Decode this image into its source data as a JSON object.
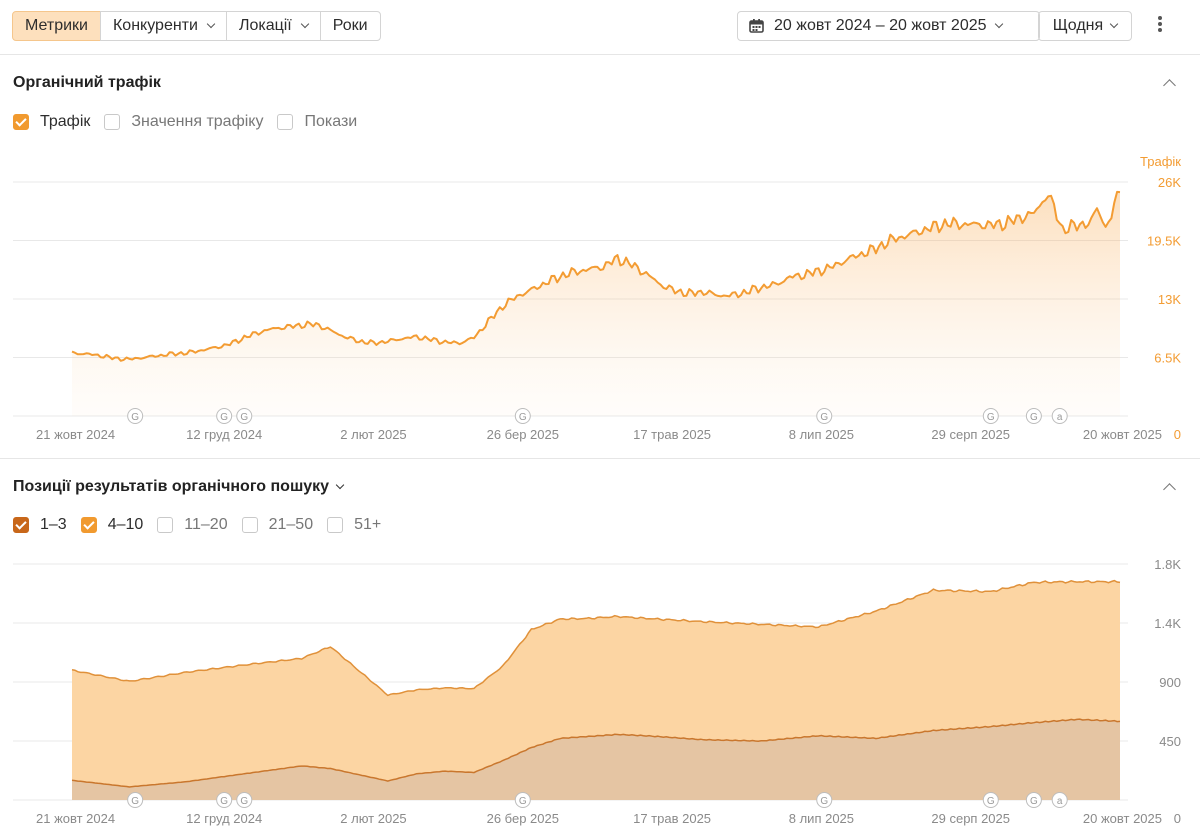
{
  "toolbar": {
    "tabs": [
      {
        "label": "Метрики",
        "active": true,
        "dropdown": false
      },
      {
        "label": "Конкуренти",
        "active": false,
        "dropdown": true
      },
      {
        "label": "Локації",
        "active": false,
        "dropdown": true
      },
      {
        "label": "Роки",
        "active": false,
        "dropdown": false
      }
    ],
    "date_range": "20 жовт 2024 – 20 жовт 2025",
    "interval": "Щодня"
  },
  "traffic_section": {
    "title": "Органічний трафік",
    "checkboxes": [
      {
        "label": "Трафік",
        "checked": true
      },
      {
        "label": "Значення трафіку",
        "checked": false
      },
      {
        "label": "Покази",
        "checked": false
      }
    ]
  },
  "positions_section": {
    "title": "Позиції результатів органічного пошуку",
    "checkboxes": [
      {
        "label": "1–3",
        "checked": true
      },
      {
        "label": "4–10",
        "checked": true
      },
      {
        "label": "11–20",
        "checked": false
      },
      {
        "label": "21–50",
        "checked": false
      },
      {
        "label": "51+",
        "checked": false
      }
    ]
  },
  "colors": {
    "traffic": "#f39c33",
    "pos_4_10": "#fcd5a3",
    "pos_1_3": "#e5c5a3",
    "pos_line": "#e0913a"
  },
  "chart_data": [
    {
      "type": "area",
      "name": "Органічний трафік",
      "y_axis_title": "Трафік",
      "x_ticks": [
        "21 жовт 2024",
        "12 груд 2024",
        "2 лют 2025",
        "26 бер 2025",
        "17 трав 2025",
        "8 лип 2025",
        "29 серп 2025",
        "20 жовт 2025"
      ],
      "x_ticks_days": [
        1,
        53,
        105,
        157,
        209,
        261,
        313,
        365
      ],
      "y_ticks": [
        "0",
        "6.5K",
        "13K",
        "19.5K",
        "26K"
      ],
      "ylim": [
        0,
        26000
      ],
      "series": [
        {
          "name": "Трафік",
          "days": [
            0,
            5,
            10,
            15,
            20,
            25,
            30,
            35,
            40,
            45,
            50,
            55,
            60,
            65,
            70,
            75,
            80,
            85,
            90,
            95,
            100,
            105,
            110,
            115,
            120,
            125,
            130,
            135,
            140,
            145,
            150,
            155,
            160,
            165,
            170,
            175,
            180,
            185,
            190,
            195,
            200,
            205,
            210,
            215,
            220,
            225,
            230,
            235,
            240,
            245,
            250,
            255,
            260,
            265,
            270,
            275,
            280,
            285,
            290,
            295,
            300,
            305,
            310,
            315,
            320,
            325,
            330,
            335,
            340,
            345,
            350,
            355,
            357,
            360,
            362,
            365
          ],
          "values": [
            7000,
            6900,
            6700,
            6400,
            6300,
            6500,
            6700,
            6900,
            7000,
            7300,
            7600,
            8000,
            8700,
            9300,
            9700,
            9900,
            10100,
            10200,
            9500,
            8800,
            8300,
            8100,
            8300,
            8600,
            8800,
            8500,
            8200,
            8100,
            8700,
            10500,
            12200,
            13300,
            14000,
            14800,
            15500,
            16000,
            16300,
            16600,
            17500,
            16800,
            15800,
            14600,
            13900,
            13600,
            13800,
            13400,
            13400,
            13800,
            14300,
            14600,
            15400,
            15700,
            16100,
            16600,
            17400,
            18000,
            18600,
            19500,
            20000,
            20500,
            21000,
            21400,
            21300,
            21300,
            21200,
            21400,
            22000,
            22500,
            24700,
            20700,
            21200,
            21500,
            23200,
            21000,
            22100,
            25600
          ]
        }
      ],
      "markers": [
        {
          "day": 22,
          "label": "G"
        },
        {
          "day": 53,
          "label": "G"
        },
        {
          "day": 60,
          "label": "G"
        },
        {
          "day": 157,
          "label": "G"
        },
        {
          "day": 262,
          "label": "G"
        },
        {
          "day": 320,
          "label": "G"
        },
        {
          "day": 335,
          "label": "G"
        },
        {
          "day": 344,
          "label": "a"
        }
      ]
    },
    {
      "type": "area",
      "name": "Позиції результатів органічного пошуку",
      "stacked": true,
      "x_ticks": [
        "21 жовт 2024",
        "12 груд 2024",
        "2 лют 2025",
        "26 бер 2025",
        "17 трав 2025",
        "8 лип 2025",
        "29 серп 2025",
        "20 жовт 2025"
      ],
      "x_ticks_days": [
        1,
        53,
        105,
        157,
        209,
        261,
        313,
        365
      ],
      "y_ticks": [
        "0",
        "450",
        "900",
        "1.4K",
        "1.8K"
      ],
      "ylim": [
        0,
        1800
      ],
      "series": [
        {
          "name": "1–3",
          "days": [
            0,
            20,
            40,
            60,
            80,
            90,
            110,
            120,
            130,
            140,
            150,
            160,
            170,
            180,
            190,
            200,
            220,
            240,
            260,
            280,
            300,
            320,
            335,
            350,
            365
          ],
          "values": [
            150,
            100,
            140,
            200,
            260,
            240,
            145,
            200,
            220,
            210,
            300,
            400,
            470,
            485,
            500,
            490,
            460,
            450,
            490,
            470,
            530,
            560,
            590,
            615,
            600
          ]
        },
        {
          "name": "4–10",
          "days": [
            0,
            20,
            40,
            60,
            80,
            90,
            110,
            120,
            130,
            140,
            150,
            160,
            170,
            180,
            190,
            200,
            220,
            240,
            260,
            280,
            300,
            320,
            335,
            350,
            365
          ],
          "values": [
            840,
            805,
            835,
            830,
            820,
            930,
            655,
            640,
            635,
            640,
            720,
            900,
            910,
            900,
            900,
            895,
            900,
            890,
            830,
            970,
            1070,
            1030,
            1070,
            1050,
            1065
          ]
        }
      ],
      "markers": [
        {
          "day": 22,
          "label": "G"
        },
        {
          "day": 53,
          "label": "G"
        },
        {
          "day": 60,
          "label": "G"
        },
        {
          "day": 157,
          "label": "G"
        },
        {
          "day": 262,
          "label": "G"
        },
        {
          "day": 320,
          "label": "G"
        },
        {
          "day": 335,
          "label": "G"
        },
        {
          "day": 344,
          "label": "a"
        }
      ]
    }
  ]
}
